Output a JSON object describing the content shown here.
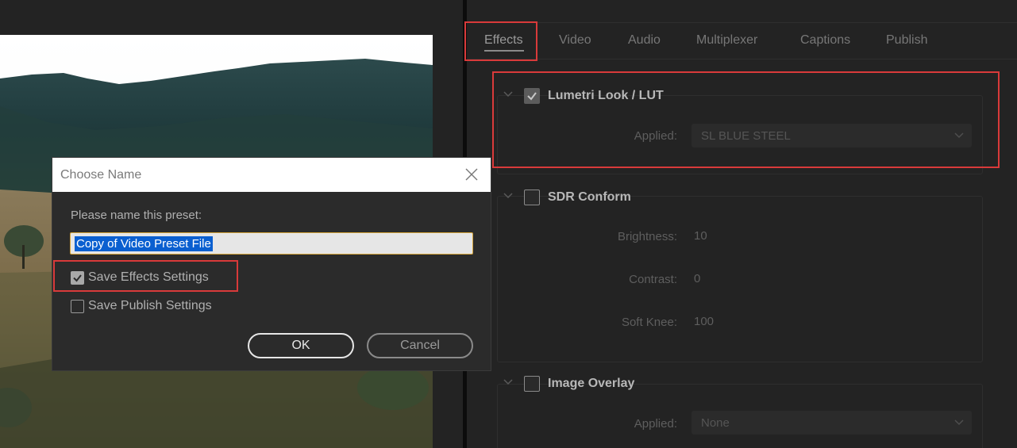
{
  "tabs": [
    {
      "label": "Effects",
      "active": true
    },
    {
      "label": "Video",
      "active": false
    },
    {
      "label": "Audio",
      "active": false
    },
    {
      "label": "Multiplexer",
      "active": false
    },
    {
      "label": "Captions",
      "active": false
    },
    {
      "label": "Publish",
      "active": false
    }
  ],
  "sections": {
    "lumetri": {
      "title": "Lumetri Look / LUT",
      "checked": true,
      "applied_label": "Applied:",
      "applied_value": "SL BLUE STEEL"
    },
    "sdr": {
      "title": "SDR Conform",
      "checked": false,
      "brightness_label": "Brightness:",
      "brightness_value": "10",
      "contrast_label": "Contrast:",
      "contrast_value": "0",
      "softknee_label": "Soft Knee:",
      "softknee_value": "100"
    },
    "overlay": {
      "title": "Image Overlay",
      "checked": false,
      "applied_label": "Applied:",
      "applied_value": "None"
    }
  },
  "dialog": {
    "title": "Choose Name",
    "prompt": "Please name this preset:",
    "input_value": "Copy of Video Preset File",
    "save_effects_label": "Save Effects Settings",
    "save_effects_checked": true,
    "save_publish_label": "Save Publish Settings",
    "save_publish_checked": false,
    "ok_label": "OK",
    "cancel_label": "Cancel"
  },
  "icons": {
    "close": "close-icon",
    "chevron": "chevron-down-icon",
    "check": "checkmark-icon",
    "dropdown": "dropdown-arrow-icon"
  },
  "colors": {
    "highlight": "#d93a3a",
    "selection": "#0a5fd0",
    "input_focus": "#d4a33a",
    "panel_bg": "#232323"
  }
}
